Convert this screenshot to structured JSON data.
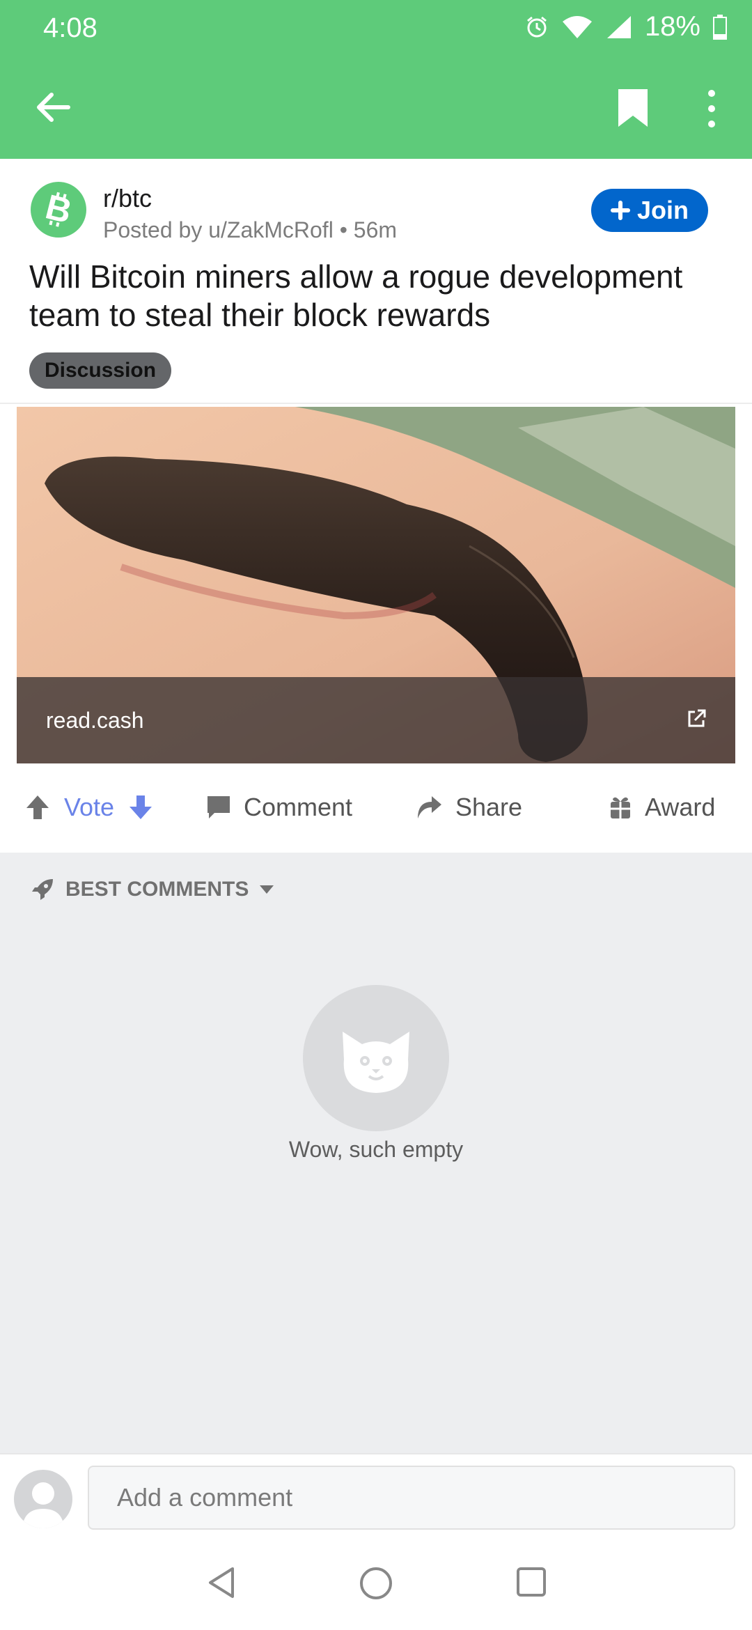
{
  "status_bar": {
    "time": "4:08",
    "battery_text": "18%",
    "icons": [
      "alarm-icon",
      "wifi-icon",
      "signal-icon",
      "battery-icon"
    ]
  },
  "app_bar": {
    "icons": [
      "back-arrow-icon",
      "bookmark-icon",
      "more-vertical-icon"
    ],
    "background": "#5ecb7a"
  },
  "post": {
    "subreddit": "r/btc",
    "meta": "Posted by u/ZakMcRofl • 56m",
    "join_label": "Join",
    "title": "Will Bitcoin miners allow a rogue development team to steal their block rewards",
    "flair": "Discussion",
    "link_domain": "read.cash",
    "subreddit_icon": "bitcoin-icon",
    "accent": "#0266cc"
  },
  "actions": {
    "vote_label": "Vote",
    "comment_label": "Comment",
    "share_label": "Share",
    "award_label": "Award"
  },
  "comments": {
    "sort_label": "BEST COMMENTS",
    "empty_text": "Wow, such empty"
  },
  "composer": {
    "placeholder": "Add a comment"
  }
}
